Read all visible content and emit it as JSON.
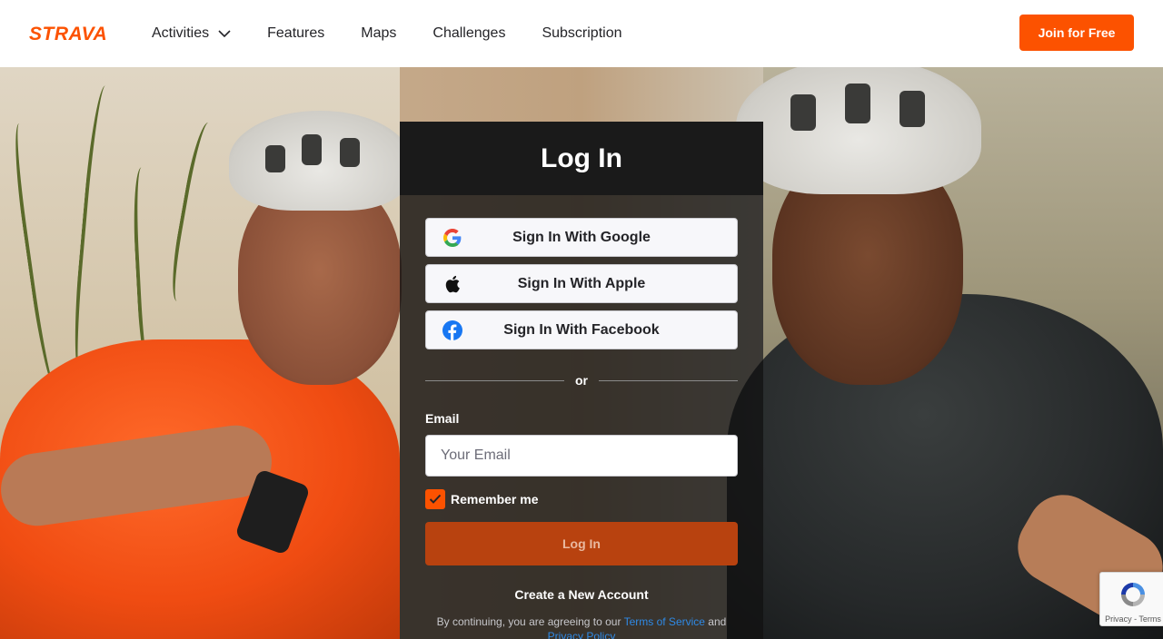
{
  "header": {
    "logo_text": "STRAVA",
    "nav": [
      {
        "label": "Activities",
        "has_dropdown": true
      },
      {
        "label": "Features"
      },
      {
        "label": "Maps"
      },
      {
        "label": "Challenges"
      },
      {
        "label": "Subscription"
      }
    ],
    "join_label": "Join for Free"
  },
  "login": {
    "title": "Log In",
    "google_label": "Sign In With Google",
    "apple_label": "Sign In With Apple",
    "facebook_label": "Sign In With Facebook",
    "divider_text": "or",
    "email_label": "Email",
    "email_placeholder": "Your Email",
    "email_value": "",
    "remember_label": "Remember me",
    "remember_checked": true,
    "submit_label": "Log In",
    "create_account": "Create a New Account",
    "terms_prefix": "By continuing, you are agreeing to our ",
    "terms_link": "Terms of Service",
    "terms_mid": " and",
    "privacy_link": "Privacy Policy"
  },
  "recaptcha": {
    "privacy": "Privacy",
    "separator": " - ",
    "terms": "Terms"
  },
  "colors": {
    "brand": "#fc5200",
    "link": "#2f8ae6",
    "facebook": "#1877f2"
  },
  "icons": {
    "logo": "strava-logo",
    "activities_dropdown": "chevron-down-icon",
    "google": "google-icon",
    "apple": "apple-icon",
    "facebook": "facebook-icon",
    "checkbox": "checkmark-icon",
    "recaptcha": "recaptcha-icon"
  }
}
